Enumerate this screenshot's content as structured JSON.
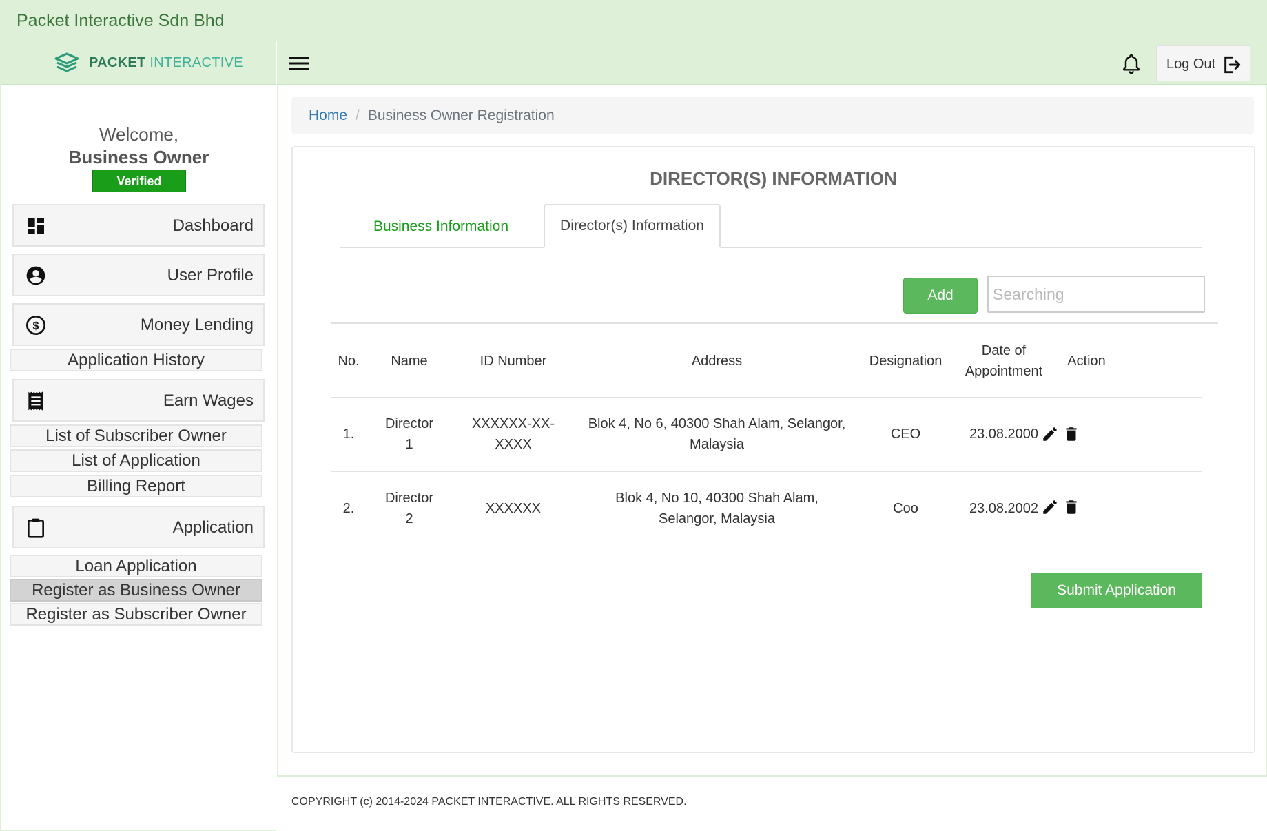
{
  "app": {
    "title": "Packet Interactive Sdn Bhd"
  },
  "logo": {
    "bold": "PACKET",
    "light": "INTERACTIVE"
  },
  "user": {
    "welcome": "Welcome,",
    "role": "Business Owner",
    "badge": "Verified"
  },
  "sidebar": {
    "dashboard": "Dashboard",
    "user_profile": "User Profile",
    "money_lending": "Money Lending",
    "application_history": "Application History",
    "earn_wages": "Earn Wages",
    "list_subscriber_owner": "List of Subscriber Owner",
    "list_application": "List of Application",
    "billing_report": "Billing Report",
    "application": "Application",
    "loan_application": "Loan Application",
    "register_business_owner": "Register as Business Owner",
    "register_subscriber_owner": "Register as Subscriber Owner"
  },
  "header": {
    "logout": "Log Out"
  },
  "breadcrumb": {
    "home": "Home",
    "current": "Business Owner Registration"
  },
  "card": {
    "title": "DIRECTOR(S) INFORMATION",
    "tabs": [
      "Business Information",
      "Director(s) Information"
    ],
    "add_label": "Add",
    "search_placeholder": "Searching",
    "submit_label": "Submit Application"
  },
  "table": {
    "headers": [
      "No.",
      "Name",
      "ID Number",
      "Address",
      "Designation",
      "Date of Appointment",
      "Action"
    ],
    "rows": [
      [
        "1.",
        "Director 1",
        "XXXXXX-XX-XXXX",
        "Blok 4, No 6, 40300 Shah Alam, Selangor, Malaysia",
        "CEO",
        "23.08.2000"
      ],
      [
        "2.",
        "Director 2",
        "XXXXXX",
        "Blok 4, No 10, 40300 Shah Alam, Selangor, Malaysia",
        "Coo",
        "23.08.2002"
      ]
    ]
  },
  "footer": {
    "copyright": "COPYRIGHT (c) 2014-2024 PACKET INTERACTIVE. ALL RIGHTS RESERVED."
  },
  "colors": {
    "header_bg": "#dff0d8",
    "accent_green": "#5cb85c",
    "verified_green": "#1a9e1a",
    "link_blue": "#337ab7"
  }
}
